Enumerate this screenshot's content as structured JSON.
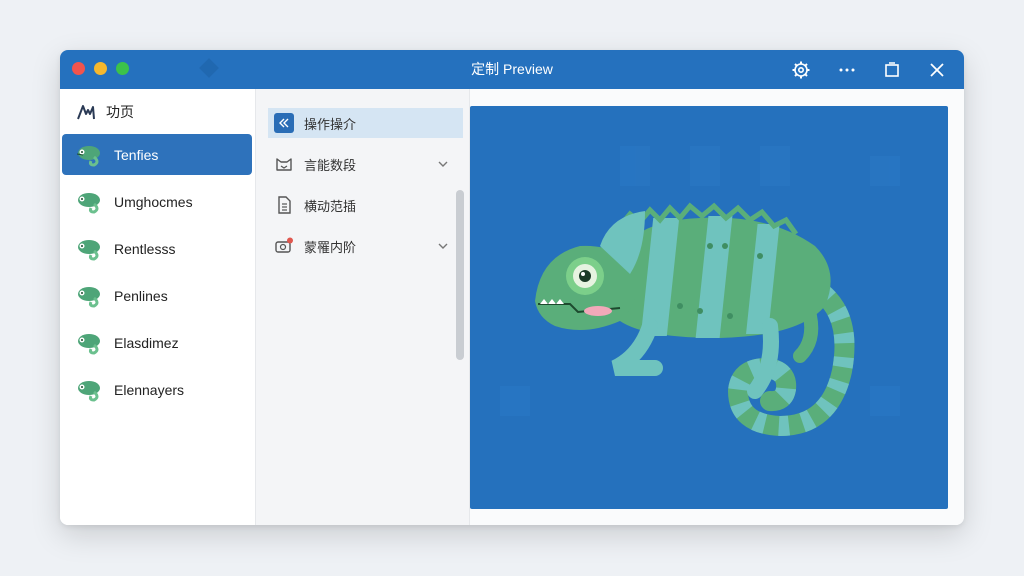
{
  "window": {
    "title": "定制 Preview",
    "buttons": [
      "settings",
      "more",
      "maximize",
      "close"
    ]
  },
  "sidebar": {
    "home": {
      "label": "功页",
      "icon": "home-logo-icon"
    },
    "items": [
      {
        "label": "Tenfies",
        "icon": "chameleon-icon",
        "active": true
      },
      {
        "label": "Umghocmes",
        "icon": "chameleon-icon",
        "active": false
      },
      {
        "label": "Rentlesss",
        "icon": "chameleon-icon",
        "active": false
      },
      {
        "label": "Penlines",
        "icon": "chameleon-icon",
        "active": false
      },
      {
        "label": "Elasdimez",
        "icon": "chameleon-icon",
        "active": false
      },
      {
        "label": "Elennayers",
        "icon": "chameleon-icon",
        "active": false
      }
    ]
  },
  "menu": {
    "items": [
      {
        "label": "操作操介",
        "icon": "collapse-left-icon",
        "active": true
      },
      {
        "label": "言能数段",
        "icon": "cat-face-icon",
        "expandable": true
      },
      {
        "label": "横动范插",
        "icon": "document-icon",
        "expandable": false
      },
      {
        "label": "蒙罹内阶",
        "icon": "camera-badge-icon",
        "expandable": true
      }
    ]
  },
  "preview": {
    "subject": "chameleon-illustration",
    "background_color": "#2571bd"
  },
  "colors": {
    "titlebar": "#2571be",
    "accent": "#2e72bb",
    "selected_menu": "#d5e5f3",
    "chameleon_green": "#5aae7a",
    "chameleon_teal": "#6fc3be"
  }
}
